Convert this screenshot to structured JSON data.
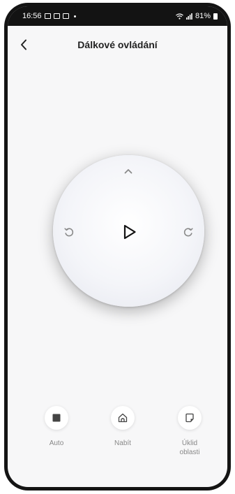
{
  "statusbar": {
    "time": "16:56",
    "battery": "81%"
  },
  "header": {
    "title": "Dálkové ovládání",
    "back_icon": "chevron-left-icon"
  },
  "dial": {
    "up_icon": "chevron-up-icon",
    "rotate_left_icon": "rotate-ccw-icon",
    "play_icon": "play-icon",
    "rotate_right_icon": "rotate-cw-icon"
  },
  "actions": [
    {
      "label": "Auto",
      "icon": "stop-square-icon"
    },
    {
      "label": "Nabít",
      "icon": "home-icon"
    },
    {
      "label": "Úklid\noblasti",
      "icon": "area-clean-icon"
    }
  ],
  "colors": {
    "text": "#222222",
    "muted": "#888888",
    "icon": "#8a8a8a",
    "background": "#f7f7f8"
  }
}
